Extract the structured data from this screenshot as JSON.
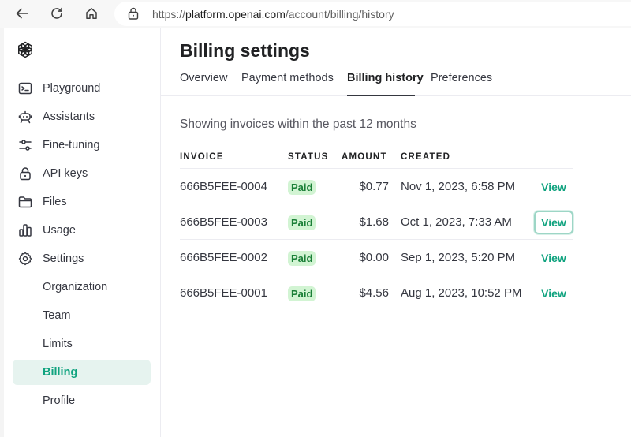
{
  "browser": {
    "url_prefix": "https://",
    "url_host": "platform.openai.com",
    "url_path": "/account/billing/history"
  },
  "sidebar": {
    "items": [
      {
        "label": "Playground",
        "icon": "terminal-icon"
      },
      {
        "label": "Assistants",
        "icon": "robot-icon"
      },
      {
        "label": "Fine-tuning",
        "icon": "sliders-icon"
      },
      {
        "label": "API keys",
        "icon": "lock-icon"
      },
      {
        "label": "Files",
        "icon": "folder-icon"
      },
      {
        "label": "Usage",
        "icon": "bar-chart-icon"
      },
      {
        "label": "Settings",
        "icon": "gear-icon"
      },
      {
        "label": "Organization"
      },
      {
        "label": "Team"
      },
      {
        "label": "Limits"
      },
      {
        "label": "Billing",
        "active": true
      },
      {
        "label": "Profile"
      }
    ]
  },
  "main": {
    "title": "Billing settings",
    "tabs": [
      {
        "label": "Overview"
      },
      {
        "label": "Payment methods"
      },
      {
        "label": "Billing history",
        "active": true
      },
      {
        "label": "Preferences"
      }
    ],
    "subtitle": "Showing invoices within the past 12 months",
    "table": {
      "headers": [
        "INVOICE",
        "STATUS",
        "AMOUNT",
        "CREATED"
      ],
      "rows": [
        {
          "invoice": "666B5FEE-0004",
          "status": "Paid",
          "amount": "$0.77",
          "created": "Nov 1, 2023, 6:58 PM",
          "action": "View"
        },
        {
          "invoice": "666B5FEE-0003",
          "status": "Paid",
          "amount": "$1.68",
          "created": "Oct 1, 2023, 7:33 AM",
          "action": "View"
        },
        {
          "invoice": "666B5FEE-0002",
          "status": "Paid",
          "amount": "$0.00",
          "created": "Sep 1, 2023, 5:20 PM",
          "action": "View"
        },
        {
          "invoice": "666B5FEE-0001",
          "status": "Paid",
          "amount": "$4.56",
          "created": "Aug 1, 2023, 10:52 PM",
          "action": "View"
        }
      ]
    }
  },
  "colors": {
    "accent": "#10a37f",
    "active_bg": "#e6f3ef",
    "paid_bg": "#d2f4d3",
    "paid_text": "#1a7f37"
  }
}
